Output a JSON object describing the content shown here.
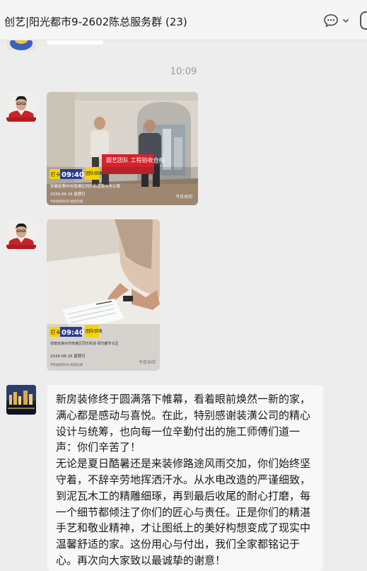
{
  "header": {
    "title": "创艺|阳光都市9-2602陈总服务群 (23)",
    "icons": [
      "chat-bubble-icon",
      "chevron-down-icon"
    ]
  },
  "chat": {
    "timestamp": "10:09",
    "messages": [
      {
        "type": "image",
        "sender_avatar": "man-in-red-shirt-avatar",
        "stamp_label": "打卡",
        "stamp_time": "09:40",
        "stamp_tag": "团队验收",
        "sign_text": "圆艺团队 工程验收合格",
        "location": "安徽省滁州市南谯区同乐街道滁州市公寓",
        "date": "2026.08.16 星期日",
        "watermark": "今日水印",
        "footer": "手机拍照时间·拍照验真"
      },
      {
        "type": "image",
        "sender_avatar": "man-in-red-shirt-avatar",
        "stamp_label": "打卡",
        "stamp_time": "09:40",
        "stamp_tag": "团队验收",
        "location": "安徽省滁州市南谯区同乐街道·阳光都市北区",
        "date": "2026.08.16 星期日",
        "watermark": "今日水印",
        "footer": "手机拍照时间·拍照验真"
      },
      {
        "type": "text",
        "sender_avatar": "night-city-avatar",
        "text": "新房装修终于圆满落下帷幕，看着眼前焕然一新的家，满心都是感动与喜悦。在此，特别感谢装潢公司的精心设计与统筹，也向每一位辛勤付出的施工师傅们道一声：你们辛苦了！\n无论是夏日酷暑还是来装修路途风雨交加，你们始终坚守着，不辞辛劳地挥洒汗水。从水电改造的严谨细致，到泥瓦木工的精雕细琢，再到最后收尾的耐心打磨，每一个细节都倾注了你们的匠心与责任。正是你们的精湛手艺和敬业精神，才让图纸上的美好构想变成了现实中温馨舒适的家。这份用心与付出，我们全家都铭记于心。再次向大家致以最诚挚的谢意！"
      }
    ]
  }
}
